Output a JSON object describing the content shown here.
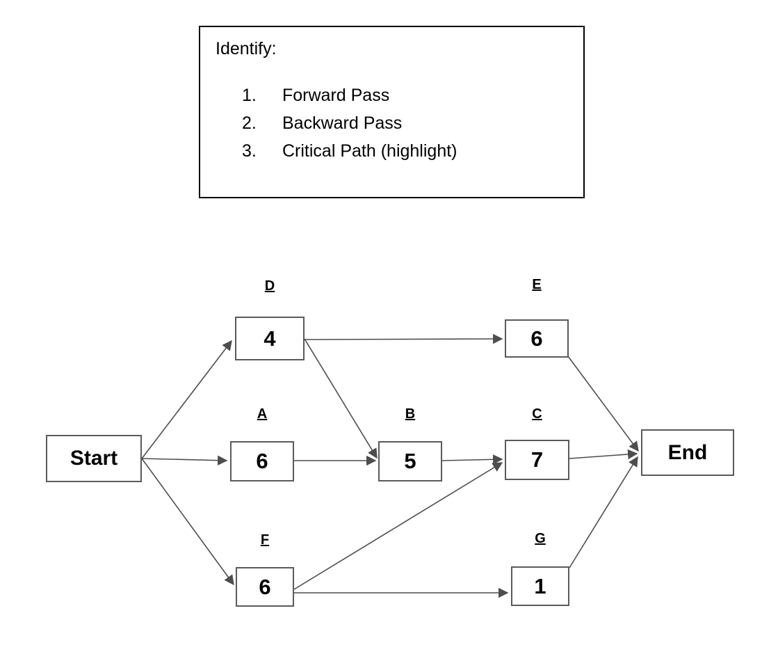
{
  "instructions": {
    "title": "Identify:",
    "items": [
      {
        "number": "1.",
        "text": "Forward Pass"
      },
      {
        "number": "2.",
        "text": "Backward Pass"
      },
      {
        "number": "3.",
        "text": "Critical Path (highlight)"
      }
    ]
  },
  "diagram": {
    "type": "activity-on-node-network",
    "start_label": "Start",
    "end_label": "End",
    "nodes": [
      {
        "id": "D",
        "label": "D",
        "duration": "4"
      },
      {
        "id": "E",
        "label": "E",
        "duration": "6"
      },
      {
        "id": "A",
        "label": "A",
        "duration": "6"
      },
      {
        "id": "B",
        "label": "B",
        "duration": "5"
      },
      {
        "id": "C",
        "label": "C",
        "duration": "7"
      },
      {
        "id": "F",
        "label": "F",
        "duration": "6"
      },
      {
        "id": "G",
        "label": "G",
        "duration": "1"
      }
    ],
    "edges": [
      {
        "from": "Start",
        "to": "D"
      },
      {
        "from": "Start",
        "to": "A"
      },
      {
        "from": "Start",
        "to": "F"
      },
      {
        "from": "D",
        "to": "E"
      },
      {
        "from": "D",
        "to": "B"
      },
      {
        "from": "A",
        "to": "B"
      },
      {
        "from": "B",
        "to": "C"
      },
      {
        "from": "F",
        "to": "C"
      },
      {
        "from": "F",
        "to": "G"
      },
      {
        "from": "E",
        "to": "End"
      },
      {
        "from": "C",
        "to": "End"
      },
      {
        "from": "G",
        "to": "End"
      }
    ],
    "colors": {
      "node_border": "#5a5a5a",
      "edge": "#4d4d4d",
      "text": "#000000",
      "box_border": "#000000"
    }
  }
}
